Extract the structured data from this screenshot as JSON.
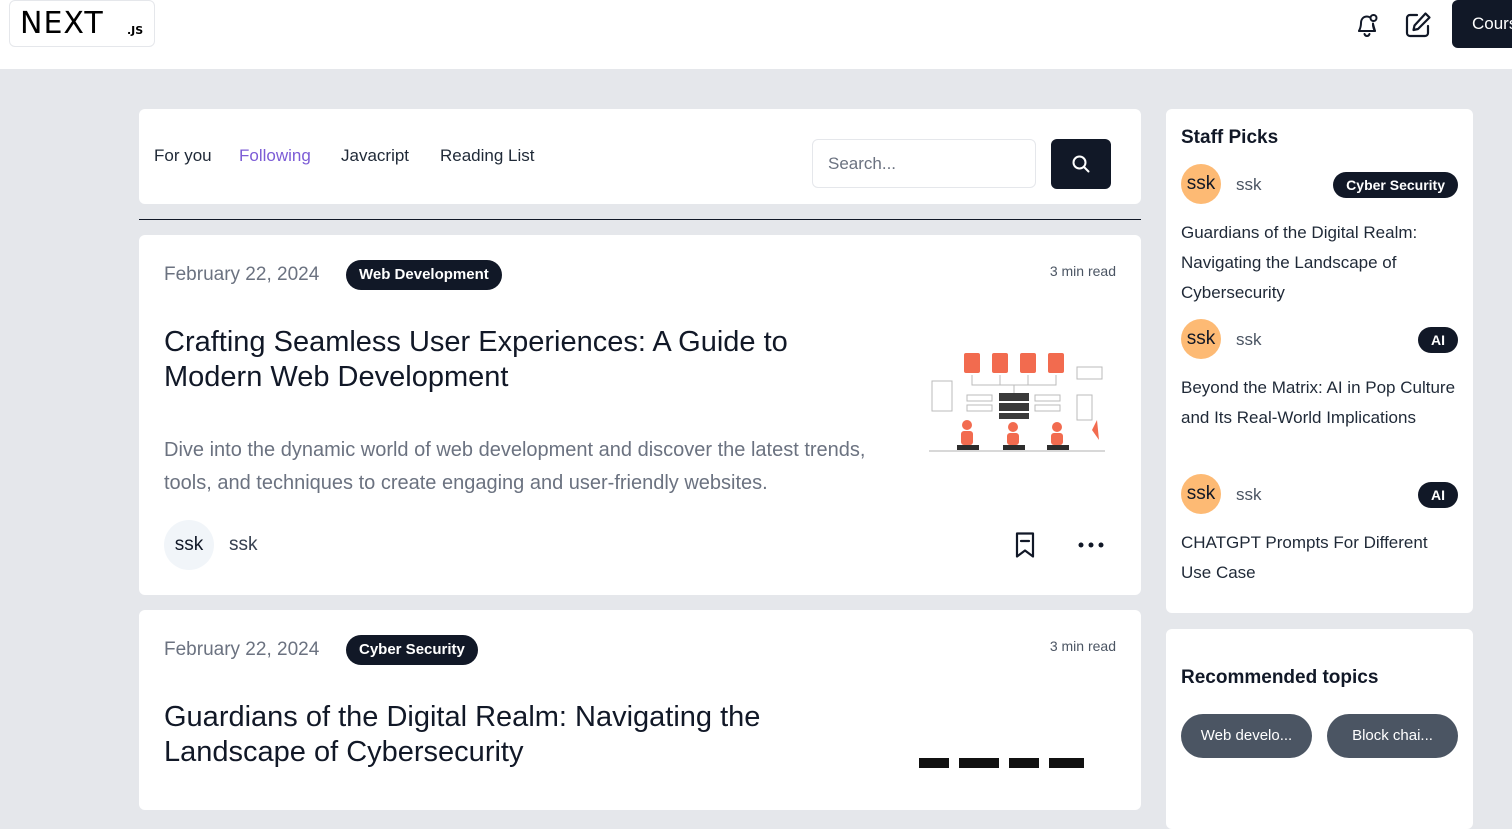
{
  "header": {
    "logo_text": "NEXT",
    "logo_sub": ".JS",
    "courses_label": "Courses"
  },
  "nav": {
    "tabs": [
      {
        "label": "For you",
        "active": false
      },
      {
        "label": "Following",
        "active": true
      },
      {
        "label": "Javacript",
        "active": false
      },
      {
        "label": "Reading List",
        "active": false
      }
    ],
    "search_placeholder": "Search...",
    "search_value": ""
  },
  "posts": [
    {
      "date": "February 22, 2024",
      "tag": "Web Development",
      "read_time": "3 min read",
      "title": "Crafting Seamless User Experiences: A Guide to Modern Web Development",
      "excerpt": "Dive into the dynamic world of web development and discover the latest trends, tools, and techniques to create engaging and user-friendly websites.",
      "author_initials": "ssk",
      "author_name": "ssk"
    },
    {
      "date": "February 22, 2024",
      "tag": "Cyber Security",
      "read_time": "3 min read",
      "title": "Guardians of the Digital Realm: Navigating the Landscape of Cybersecurity"
    }
  ],
  "staff_picks": {
    "heading": "Staff Picks",
    "items": [
      {
        "avatar": "ssk",
        "author": "ssk",
        "tag": "Cyber Security",
        "title": "Guardians of the Digital Realm: Navigating the Landscape of Cybersecurity"
      },
      {
        "avatar": "ssk",
        "author": "ssk",
        "tag": "AI",
        "title": "Beyond the Matrix: AI in Pop Culture and Its Real-World Implications"
      },
      {
        "avatar": "ssk",
        "author": "ssk",
        "tag": "AI",
        "title": "CHATGPT Prompts For Different Use Case"
      }
    ]
  },
  "recommended": {
    "heading": "Recommended topics",
    "topics": [
      "Web develo...",
      "Block chai..."
    ]
  },
  "colors": {
    "accent": "#7c5cd6",
    "dark": "#111827",
    "page_bg": "#e5e7eb",
    "avatar_orange": "#fdba74"
  }
}
